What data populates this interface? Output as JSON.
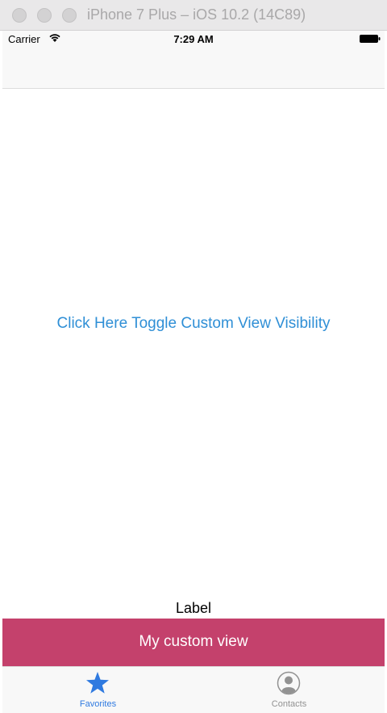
{
  "window": {
    "title": "iPhone 7 Plus – iOS 10.2 (14C89)"
  },
  "status_bar": {
    "carrier": "Carrier",
    "time": "7:29 AM",
    "wifi_icon": "wifi-icon",
    "battery_icon": "battery-icon"
  },
  "main": {
    "toggle_link": "Click Here Toggle Custom View Visibility",
    "label": "Label"
  },
  "custom_view": {
    "text": "My custom view",
    "color": "#c4416c"
  },
  "tab_bar": {
    "items": [
      {
        "label": "Favorites",
        "icon": "star-icon",
        "selected": true
      },
      {
        "label": "Contacts",
        "icon": "contact-icon",
        "selected": false
      }
    ]
  },
  "colors": {
    "link": "#2f8fd6",
    "tab_selected": "#2f7ae0",
    "tab_unselected": "#929292"
  }
}
